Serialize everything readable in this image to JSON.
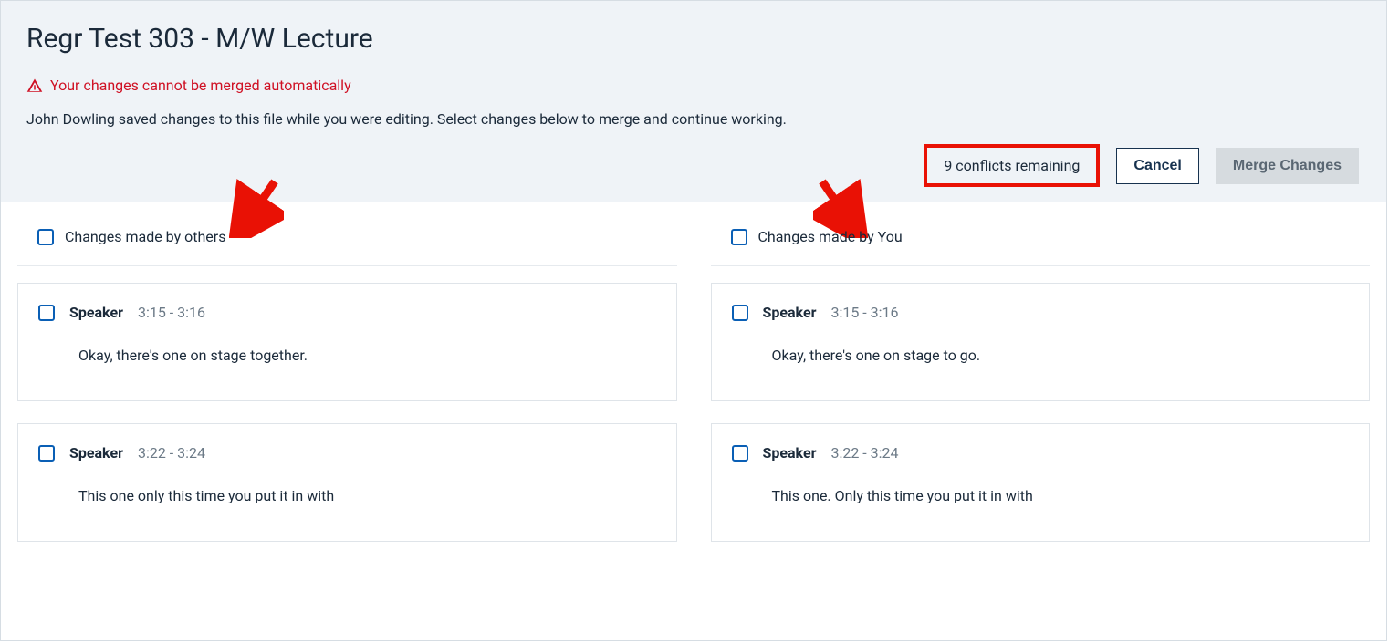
{
  "header": {
    "title": "Regr Test 303 - M/W Lecture",
    "alert": "Your changes cannot be merged automatically",
    "subtext": "John Dowling saved changes to this file while you were editing. Select changes below to merge and continue working.",
    "conflict_badge": "9 conflicts remaining",
    "cancel_label": "Cancel",
    "merge_label": "Merge Changes"
  },
  "columns": {
    "others": {
      "heading": "Changes made by others",
      "items": [
        {
          "speaker": "Speaker",
          "time": "3:15 - 3:16",
          "text": "Okay, there's one on stage together."
        },
        {
          "speaker": "Speaker",
          "time": "3:22 - 3:24",
          "text": "This one only this time you put it in with"
        }
      ]
    },
    "you": {
      "heading": "Changes made by You",
      "items": [
        {
          "speaker": "Speaker",
          "time": "3:15 - 3:16",
          "text": "Okay, there's one on stage to go."
        },
        {
          "speaker": "Speaker",
          "time": "3:22 - 3:24",
          "text": "This one. Only this time you put it in with"
        }
      ]
    }
  },
  "annotation_color": "#e91105"
}
